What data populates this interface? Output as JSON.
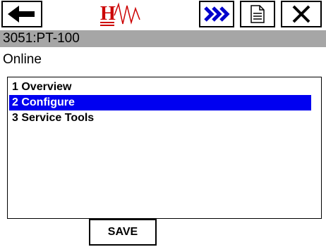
{
  "toolbar": {
    "back_icon": "arrow-left-icon",
    "logo_text": "H",
    "next_icon": "double-chevron-right-icon",
    "doc_icon": "document-icon",
    "close_icon": "close-icon",
    "accent_color": "#0000cc",
    "logo_color": "#cc0000"
  },
  "device": {
    "title": "3051:PT-100",
    "status": "Online"
  },
  "menu": {
    "selected_color": "#0000f0",
    "items": [
      {
        "label": "1 Overview"
      },
      {
        "label": "2 Configure"
      },
      {
        "label": "3 Service Tools"
      }
    ]
  },
  "footer": {
    "save_label": "SAVE"
  }
}
